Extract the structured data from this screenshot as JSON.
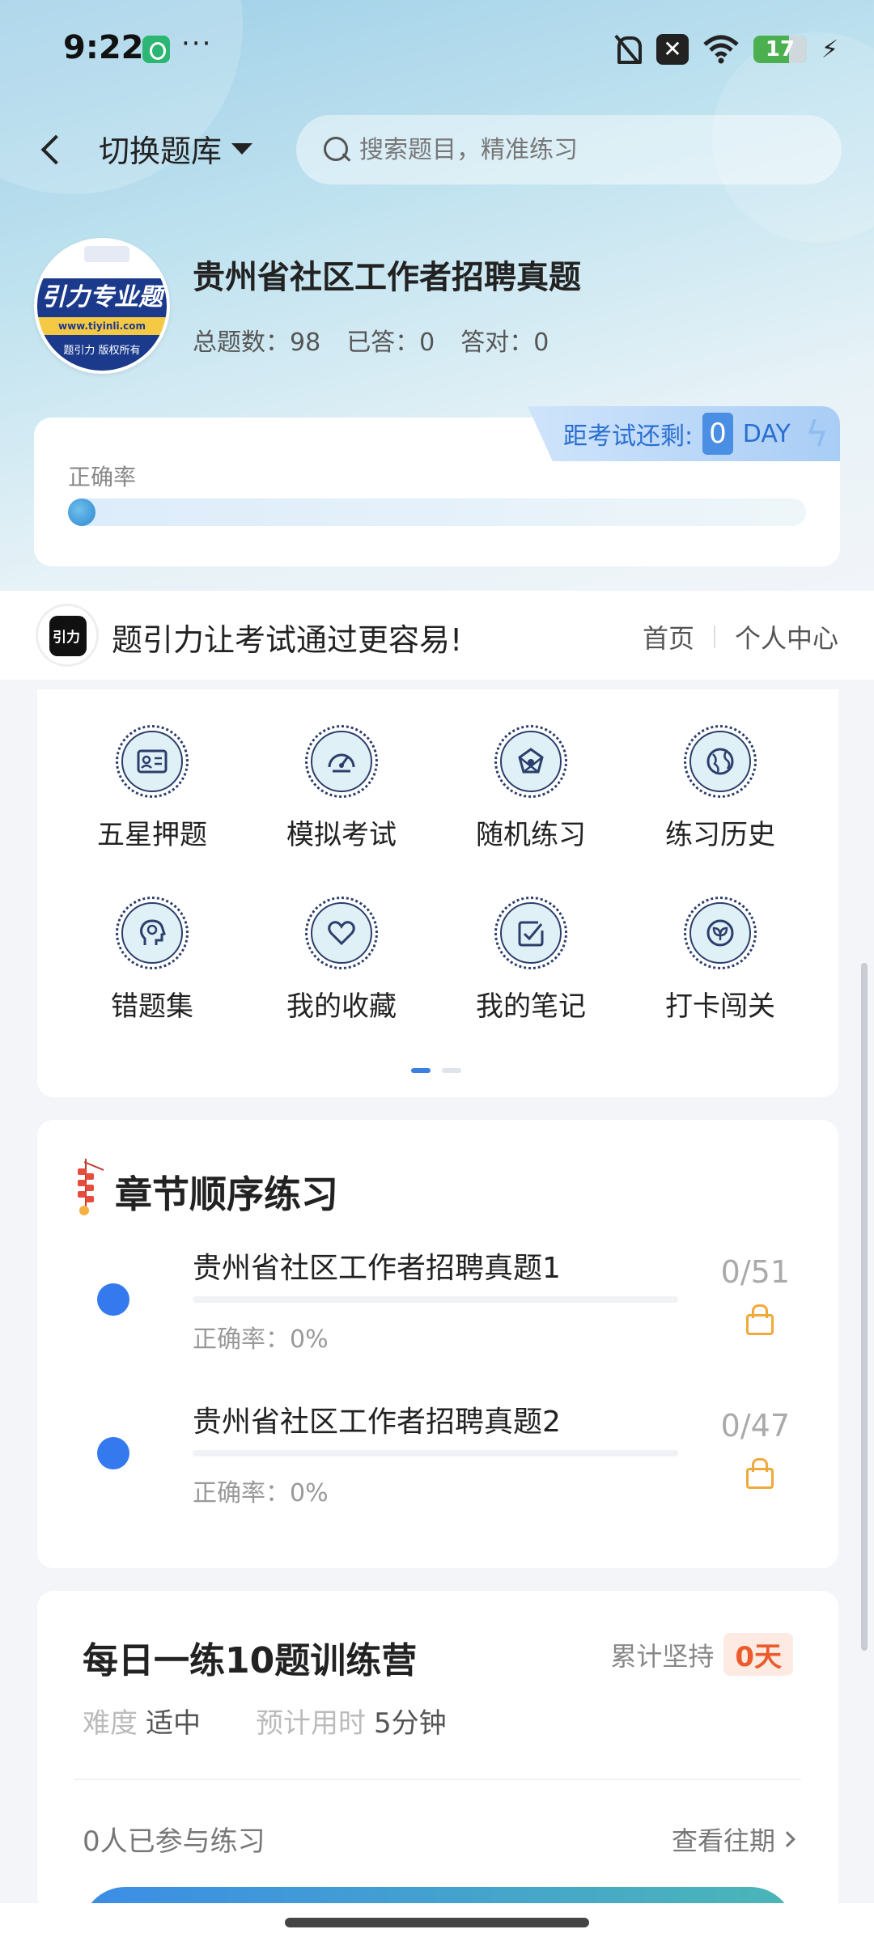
{
  "status_bar": {
    "time": "9:22",
    "dots": "···",
    "battery": "17"
  },
  "header": {
    "switch_bank_label": "切换题库",
    "search_placeholder": "搜索题目，精准练习"
  },
  "bank": {
    "title": "贵州省社区工作者招聘真题",
    "logo_text": "引力专业题",
    "logo_url": "www.tiyinli.com",
    "logo_footer": "题引力 版权所有",
    "total_label": "总题数：98",
    "answered_label": "已答：0",
    "correct_label": "答对：0"
  },
  "accuracy_card": {
    "exam_countdown_label": "距考试还剩:",
    "exam_countdown_value": "0",
    "exam_countdown_unit": "DAY",
    "accuracy_label": "正确率",
    "accuracy_value": 0
  },
  "banner": {
    "text": "题引力让考试通过更容易!",
    "nav_home": "首页",
    "nav_profile": "个人中心"
  },
  "features": [
    {
      "label": "五星押题",
      "icon": "id-card-icon"
    },
    {
      "label": "模拟考试",
      "icon": "gauge-icon"
    },
    {
      "label": "随机练习",
      "icon": "shuffle-icon"
    },
    {
      "label": "练习历史",
      "icon": "globe-icon"
    },
    {
      "label": "错题集",
      "icon": "head-icon"
    },
    {
      "label": "我的收藏",
      "icon": "heart-icon"
    },
    {
      "label": "我的笔记",
      "icon": "note-check-icon"
    },
    {
      "label": "打卡闯关",
      "icon": "leaf-badge-icon"
    }
  ],
  "chapters": {
    "title": "章节顺序练习",
    "items": [
      {
        "title": "贵州省社区工作者招聘真题1",
        "accuracy": "正确率：0%",
        "count": "0/51"
      },
      {
        "title": "贵州省社区工作者招聘真题2",
        "accuracy": "正确率：0%",
        "count": "0/47"
      }
    ]
  },
  "daily": {
    "title": "每日一练10题训练营",
    "streak_label": "累计坚持",
    "streak_value": "0天",
    "difficulty_label": "难度",
    "difficulty_value": "适中",
    "time_label": "预计用时",
    "time_value": "5分钟",
    "joined": "0人已参与练习",
    "history_link": "查看往期"
  },
  "colors": {
    "accent": "#3479ee",
    "streak": "#ec5b2c",
    "lock": "#f0a93b",
    "icon_stroke": "#2c3e6b"
  }
}
